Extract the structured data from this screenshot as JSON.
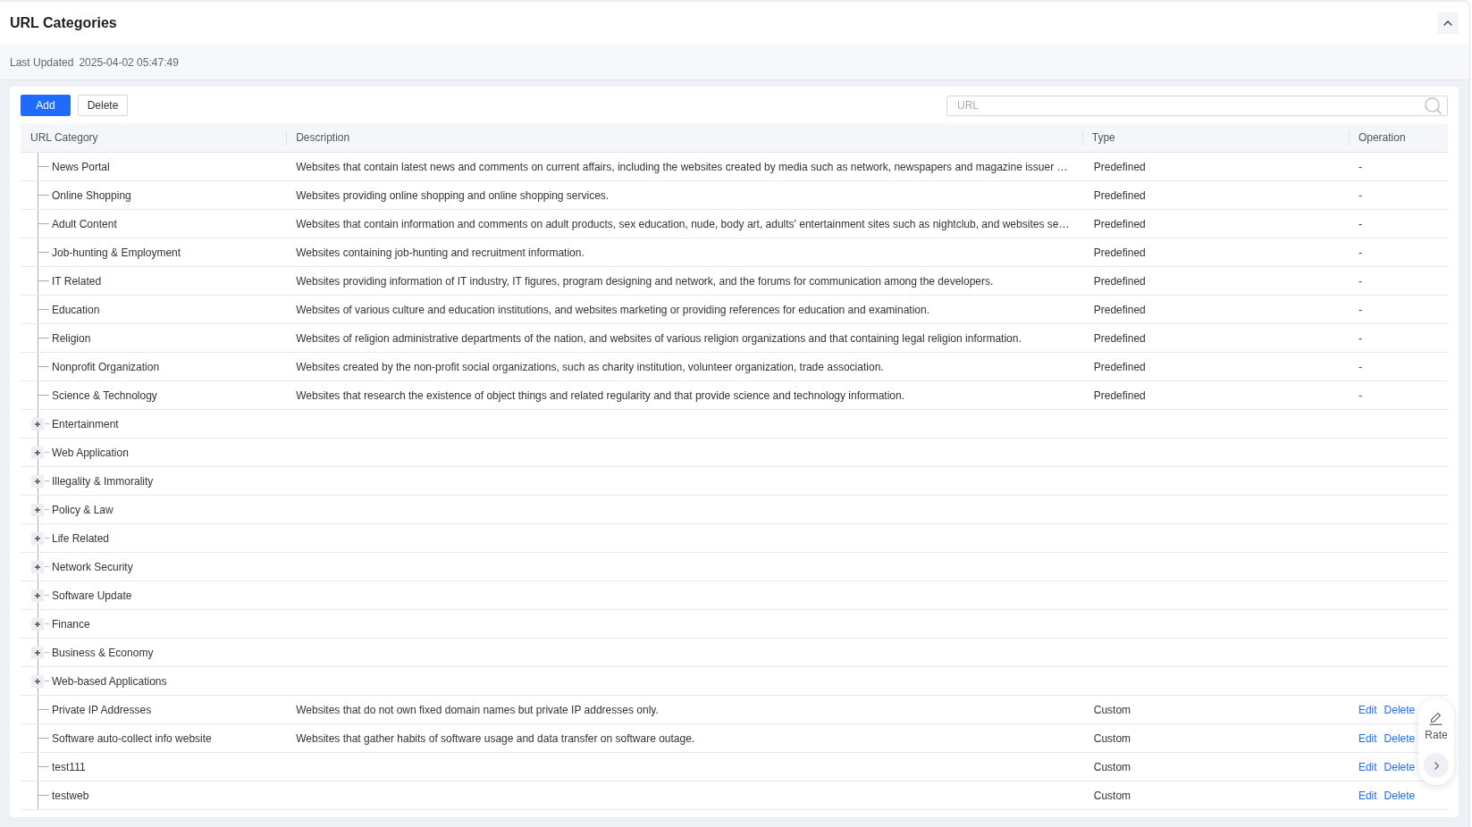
{
  "header": {
    "title": "URL Categories",
    "expanded": true
  },
  "last_updated": {
    "label": "Last Updated",
    "value": "2025-04-02 05:47:49"
  },
  "toolbar": {
    "buttons": [
      {
        "label": "Add",
        "kind": "primary"
      },
      {
        "label": "Delete",
        "kind": "default"
      }
    ],
    "search": {
      "placeholder": "URL"
    }
  },
  "table": {
    "columns": [
      "URL Category",
      "Description",
      "Type",
      "Operation"
    ],
    "rows": [
      {
        "kind": "leaf",
        "name": "News Portal",
        "description": "Websites that contain latest news and comments on current affairs, including the websites created by media such as network, newspapers and magazine issuer …",
        "type": "Predefined",
        "operation": "-"
      },
      {
        "kind": "leaf",
        "name": "Online Shopping",
        "description": "Websites providing online shopping and online shopping services.",
        "type": "Predefined",
        "operation": "-"
      },
      {
        "kind": "leaf",
        "name": "Adult Content",
        "description": "Websites that contain information and comments on adult products, sex education, nude, body art, adults' entertainment sites such as nightclub, and websites se…",
        "type": "Predefined",
        "operation": "-"
      },
      {
        "kind": "leaf",
        "name": "Job-hunting & Employment",
        "description": "Websites containing job-hunting and recruitment information.",
        "type": "Predefined",
        "operation": "-"
      },
      {
        "kind": "leaf",
        "name": "IT Related",
        "description": "Websites providing information of IT industry, IT figures, program designing and network, and the forums for communication among the developers.",
        "type": "Predefined",
        "operation": "-"
      },
      {
        "kind": "leaf",
        "name": "Education",
        "description": "Websites of various culture and education institutions, and websites marketing or providing references for education and examination.",
        "type": "Predefined",
        "operation": "-"
      },
      {
        "kind": "leaf",
        "name": "Religion",
        "description": "Websites of religion administrative departments of the nation, and websites of various religion organizations and that containing legal religion information.",
        "type": "Predefined",
        "operation": "-"
      },
      {
        "kind": "leaf",
        "name": "Nonprofit Organization",
        "description": "Websites created by the non-profit social organizations, such as charity institution, volunteer organization, trade association.",
        "type": "Predefined",
        "operation": "-"
      },
      {
        "kind": "leaf",
        "name": "Science & Technology",
        "description": "Websites that research the existence of object things and related regularity and that provide science and technology information.",
        "type": "Predefined",
        "operation": "-"
      },
      {
        "kind": "group",
        "name": "Entertainment",
        "expanded": false
      },
      {
        "kind": "group",
        "name": "Web Application",
        "expanded": false
      },
      {
        "kind": "group",
        "name": "Illegality & Immorality",
        "expanded": false
      },
      {
        "kind": "group",
        "name": "Policy & Law",
        "expanded": false
      },
      {
        "kind": "group",
        "name": "Life Related",
        "expanded": false
      },
      {
        "kind": "group",
        "name": "Network Security",
        "expanded": false
      },
      {
        "kind": "group",
        "name": "Software Update",
        "expanded": false
      },
      {
        "kind": "group",
        "name": "Finance",
        "expanded": false
      },
      {
        "kind": "group",
        "name": "Business & Economy",
        "expanded": false
      },
      {
        "kind": "group",
        "name": "Web-based Applications",
        "expanded": false
      },
      {
        "kind": "leaf",
        "name": "Private IP Addresses",
        "description": "Websites that do not own fixed domain names but private IP addresses only.",
        "type": "Custom",
        "actions": [
          "Edit",
          "Delete"
        ]
      },
      {
        "kind": "leaf",
        "name": "Software auto-collect info website",
        "description": "Websites that gather habits of software usage and data transfer on software outage.",
        "type": "Custom",
        "actions": [
          "Edit",
          "Delete"
        ]
      },
      {
        "kind": "leaf",
        "name": "test111",
        "type": "Custom",
        "actions": [
          "Edit",
          "Delete"
        ]
      },
      {
        "kind": "leaf",
        "name": "testweb",
        "type": "Custom",
        "actions": [
          "Edit",
          "Delete"
        ]
      }
    ]
  },
  "feedback": {
    "label": "Rate"
  }
}
